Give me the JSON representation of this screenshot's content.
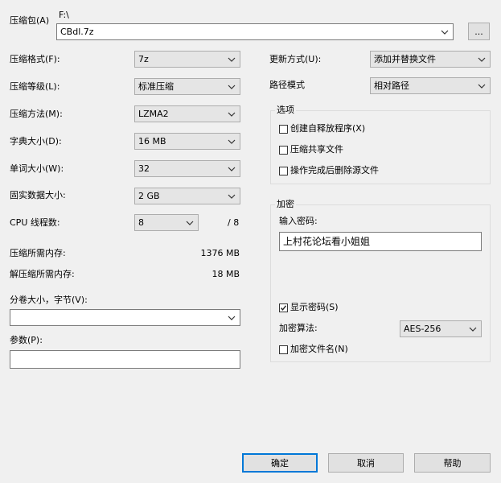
{
  "archive": {
    "label": "压缩包(A)",
    "path": "F:\\",
    "filename": "CBdl.7z",
    "browse_label": "..."
  },
  "left": {
    "format": {
      "label": "压缩格式(F):",
      "value": "7z"
    },
    "level": {
      "label": "压缩等级(L):",
      "value": "标准压缩"
    },
    "method": {
      "label": "压缩方法(M):",
      "value": "LZMA2"
    },
    "dict": {
      "label": "字典大小(D):",
      "value": "16 MB"
    },
    "word": {
      "label": "单词大小(W):",
      "value": "32"
    },
    "solid": {
      "label": "固实数据大小:",
      "value": "2 GB"
    },
    "threads": {
      "label": "CPU 线程数:",
      "value": "8",
      "max": "/ 8"
    },
    "mem_compress": {
      "label": "压缩所需内存:",
      "value": "1376 MB"
    },
    "mem_decompress": {
      "label": "解压缩所需内存:",
      "value": "18 MB"
    },
    "volume": {
      "label": "分卷大小，字节(V):",
      "value": ""
    },
    "params": {
      "label": "参数(P):",
      "value": ""
    }
  },
  "right": {
    "update": {
      "label": "更新方式(U):",
      "value": "添加并替换文件"
    },
    "path_mode": {
      "label": "路径模式",
      "value": "相对路径"
    },
    "options": {
      "title": "选项",
      "sfx": {
        "label": "创建自释放程序(X)",
        "checked": false
      },
      "shared": {
        "label": "压缩共享文件",
        "checked": false
      },
      "delete_after": {
        "label": "操作完成后删除源文件",
        "checked": false
      }
    },
    "encryption": {
      "title": "加密",
      "password_label": "输入密码:",
      "password_value": "上村花论坛看小姐姐",
      "show_password": {
        "label": "显示密码(S)",
        "checked": true
      },
      "method_label": "加密算法:",
      "method_value": "AES-256",
      "encrypt_names": {
        "label": "加密文件名(N)",
        "checked": false
      }
    }
  },
  "buttons": {
    "ok": "确定",
    "cancel": "取消",
    "help": "帮助"
  }
}
